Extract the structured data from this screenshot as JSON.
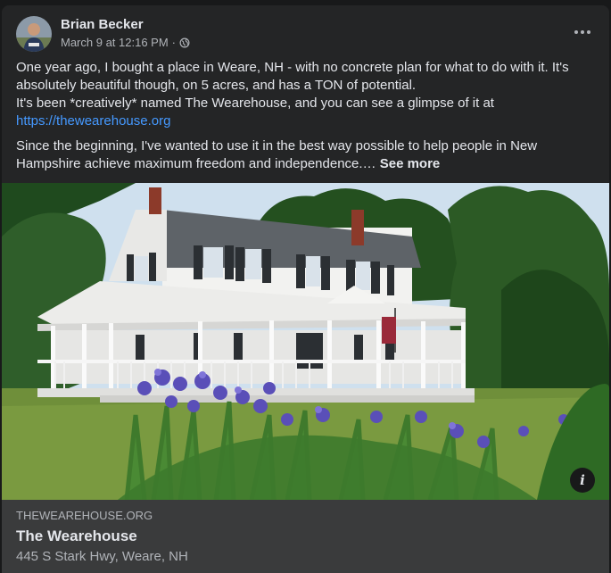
{
  "post": {
    "author": "Brian Becker",
    "timestamp": "March 9 at 12:16 PM",
    "separator": "·",
    "audience_icon": "globe-icon",
    "more_icon": "more-options-icon",
    "paragraph1_line1": "One year ago, I bought a place in Weare, NH - with no concrete plan for what to do with it. It's absolutely beautiful though, on 5 acres, and has a TON of potential.",
    "paragraph1_line2": "It's been *creatively* named The Wearehouse, and you can see a glimpse of it at",
    "link_text": "https://thewearehouse.org",
    "paragraph2": "Since the beginning, I've wanted to use it in the best way possible to help people in New Hampshire achieve maximum freedom and independence.…",
    "see_more": "See more"
  },
  "photo": {
    "info_icon": "info-icon",
    "info_label": "i"
  },
  "link_card": {
    "domain": "THEWEAREHOUSE.ORG",
    "title": "The Wearehouse",
    "subtitle": "445 S Stark Hwy, Weare, NH"
  },
  "colors": {
    "background": "#18191a",
    "card": "#242526",
    "link": "#4599ff",
    "secondary_text": "#b0b3b8"
  }
}
